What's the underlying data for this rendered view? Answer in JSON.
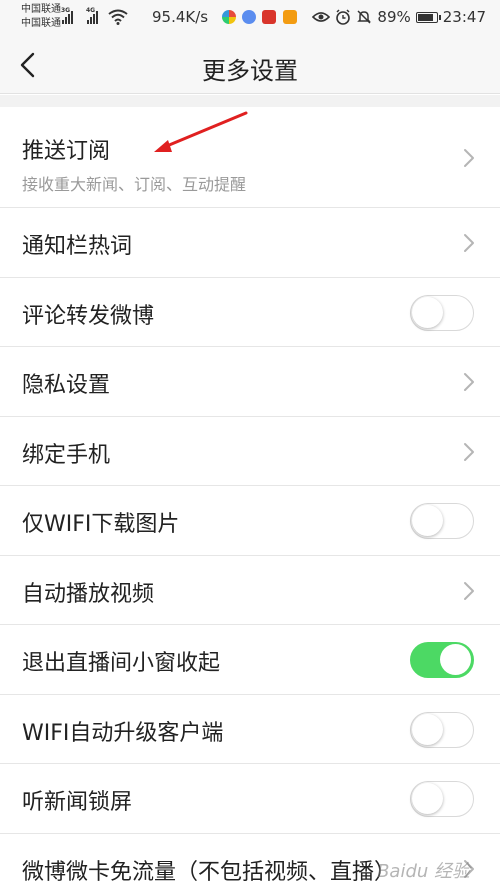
{
  "status_bar": {
    "carrier_1": "中国联通",
    "carrier_2": "中国联通",
    "signal_1_label": "3G",
    "signal_2_label": "4G",
    "net_speed": "95.4K/s",
    "battery": "89%",
    "battery_level": 0.89,
    "time": "23:47",
    "icons": [
      "signal-icon",
      "wifi-icon",
      "eye-icon",
      "alarm-icon",
      "mute-icon",
      "battery-icon"
    ]
  },
  "header": {
    "title": "更多设置",
    "back_icon": "chevron-left-icon"
  },
  "settings": {
    "items": [
      {
        "label": "推送订阅",
        "subtitle": "接收重大新闻、订阅、互动提醒",
        "control": "chevron"
      },
      {
        "label": "通知栏热词",
        "control": "chevron"
      },
      {
        "label": "评论转发微博",
        "control": "toggle",
        "on": false
      },
      {
        "label": "隐私设置",
        "control": "chevron"
      },
      {
        "label": "绑定手机",
        "control": "chevron"
      },
      {
        "label": "仅WIFI下载图片",
        "control": "toggle",
        "on": false
      },
      {
        "label": "自动播放视频",
        "control": "chevron"
      },
      {
        "label": "退出直播间小窗收起",
        "control": "toggle",
        "on": true
      },
      {
        "label": "WIFI自动升级客户端",
        "control": "toggle",
        "on": false
      },
      {
        "label": "听新闻锁屏",
        "control": "toggle",
        "on": false
      },
      {
        "label": "微博微卡免流量（不包括视频、直播）",
        "control": "chevron"
      }
    ]
  },
  "colors": {
    "toggle_on": "#4cd964",
    "annotation_arrow": "#e02020"
  }
}
